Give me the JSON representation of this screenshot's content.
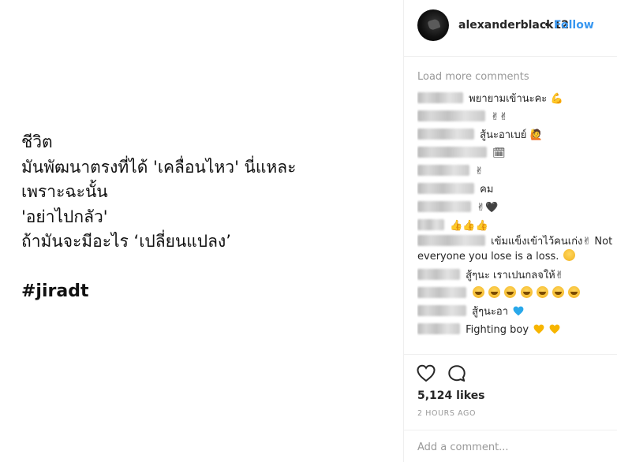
{
  "post": {
    "caption_lines": [
      "ชีวิต",
      "มันพัฒนาตรงที่ได้ 'เคลื่อนไหว' นี่แหละ",
      "เพราะฉะนั้น",
      "'อย่าไปกลัว'",
      "ถ้ามันจะมีอะไร ‘เปลี่ยนแปลง’"
    ],
    "hashtag": "#jiradt"
  },
  "header": {
    "username": "alexanderblack12",
    "separator": "•",
    "follow_label": "Follow"
  },
  "comments": {
    "load_more": "Load more comments",
    "items": [
      {
        "text": "พยายามเข้านะคะ",
        "emoji": "💪"
      },
      {
        "text": "",
        "emoji": "✌✌"
      },
      {
        "text": "สู้นะอาเบย์",
        "emoji": "🙋"
      },
      {
        "text": "",
        "emoji": "🗓"
      },
      {
        "text": "",
        "emoji": "✌"
      },
      {
        "text": "คม",
        "emoji": ""
      },
      {
        "text": "",
        "emoji": "✌🖤"
      },
      {
        "text": "",
        "emoji": "👍👍👍"
      },
      {
        "text": "เข้มแข็งเข้าไว้คนเก่ง✌ Not everyone you lose is a loss.",
        "emoji": "😊"
      },
      {
        "text": "สู้ๆนะ เราเปนกลจให้✌",
        "emoji": ""
      },
      {
        "text": "",
        "emoji": "😭😭😭😭😭😭😭"
      },
      {
        "text": "สู้ๆนะอา",
        "emoji": "💙"
      },
      {
        "text": "Fighting boy",
        "emoji": "💛💛"
      }
    ]
  },
  "actions": {
    "like_icon": "heart-outline-icon",
    "comment_icon": "speech-bubble-icon",
    "likes": "5,124 likes",
    "timestamp": "2 HOURS AGO"
  },
  "add_comment": {
    "placeholder": "Add a comment..."
  },
  "colors": {
    "link": "#3897f0",
    "muted": "#999999",
    "text": "#262626",
    "border": "#efefef"
  }
}
